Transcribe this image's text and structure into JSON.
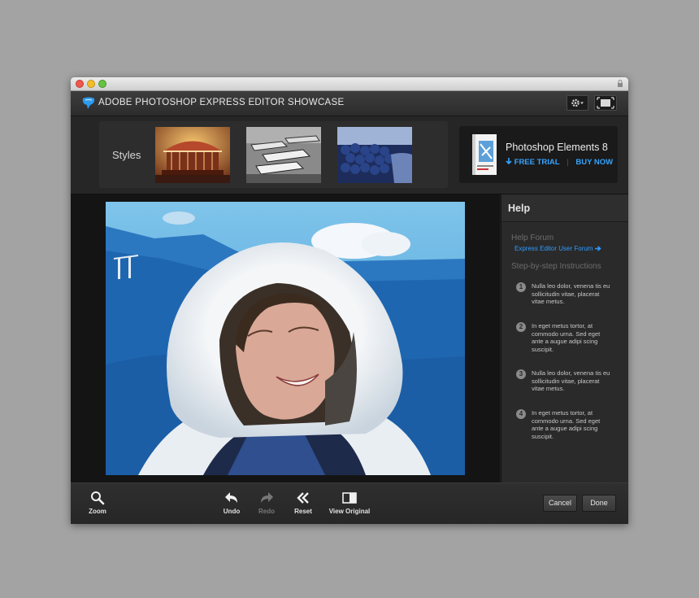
{
  "window": {
    "title": "ADOBE PHOTOSHOP EXPRESS EDITOR SHOWCASE"
  },
  "styles": {
    "label": "Styles",
    "thumbnails": [
      "carousel-photo",
      "boats-photo",
      "blueberries-photo"
    ]
  },
  "promo": {
    "product": "Photoshop Elements 8",
    "free_trial": "FREE TRIAL",
    "buy_now": "BUY NOW"
  },
  "help": {
    "title": "Help",
    "forum_heading": "Help Forum",
    "forum_link": "Express Editor User Forum",
    "instructions_heading": "Step-by-step Instructions",
    "steps": [
      {
        "num": "1",
        "text": "Nulla leo dolor, venena tis eu sollicitudin vitae, placerat vitae metus."
      },
      {
        "num": "2",
        "text": "In eget metus tortor, at commodo urna. Sed eget ante a augue adipi scing suscipit."
      },
      {
        "num": "3",
        "text": "Nulla leo dolor, venena tis eu sollicitudin vitae, placerat vitae metus."
      },
      {
        "num": "4",
        "text": "In eget metus tortor, at commodo urna. Sed eget ante a augue adipi scing suscipit."
      }
    ]
  },
  "toolbar": {
    "zoom": "Zoom",
    "undo": "Undo",
    "redo": "Redo",
    "reset": "Reset",
    "view_original": "View Original",
    "cancel": "Cancel",
    "done": "Done"
  },
  "colors": {
    "accent": "#35a3ff",
    "background": "#1f1f1f"
  }
}
